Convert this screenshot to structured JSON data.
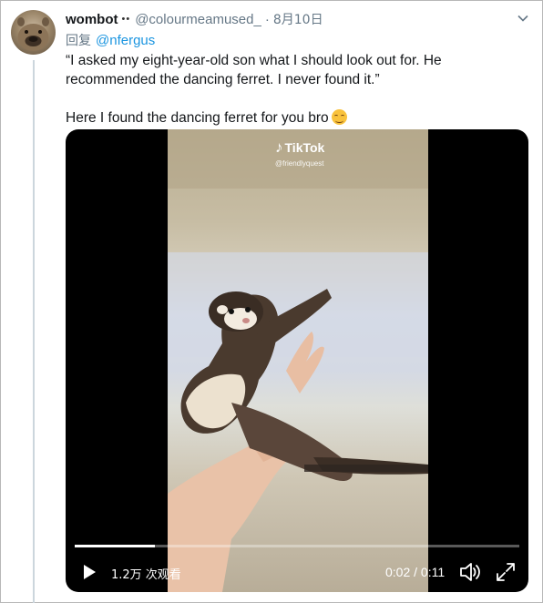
{
  "tweet": {
    "author_name": "wombot",
    "author_emoji": "••",
    "handle": "@colourmeamused_",
    "separator": "·",
    "date": "8月10日",
    "reply_label": "回复",
    "reply_to": "@nfergus",
    "text_line1": "“I asked my eight-year-old son what I should look out for. He recommended the dancing ferret. I never found it.”",
    "text_line2": "Here I found the dancing ferret for you bro",
    "text_emoji": "smiling-face-with-smiling-eyes"
  },
  "video": {
    "watermark_brand": "TikTok",
    "watermark_user": "@friendlyquest",
    "views_label": "1.2万 次观看",
    "time_label": "0:02 / 0:11",
    "progress_fraction": 0.18
  },
  "icons": {
    "avatar": "wombat-avatar",
    "caret": "chevron-down-icon",
    "play": "play-icon",
    "volume": "volume-icon",
    "fullscreen": "fullscreen-icon"
  },
  "colors": {
    "link": "#1b95e0",
    "muted": "#657786",
    "thread_line": "#ccd6dd",
    "video_bg": "#000000"
  }
}
